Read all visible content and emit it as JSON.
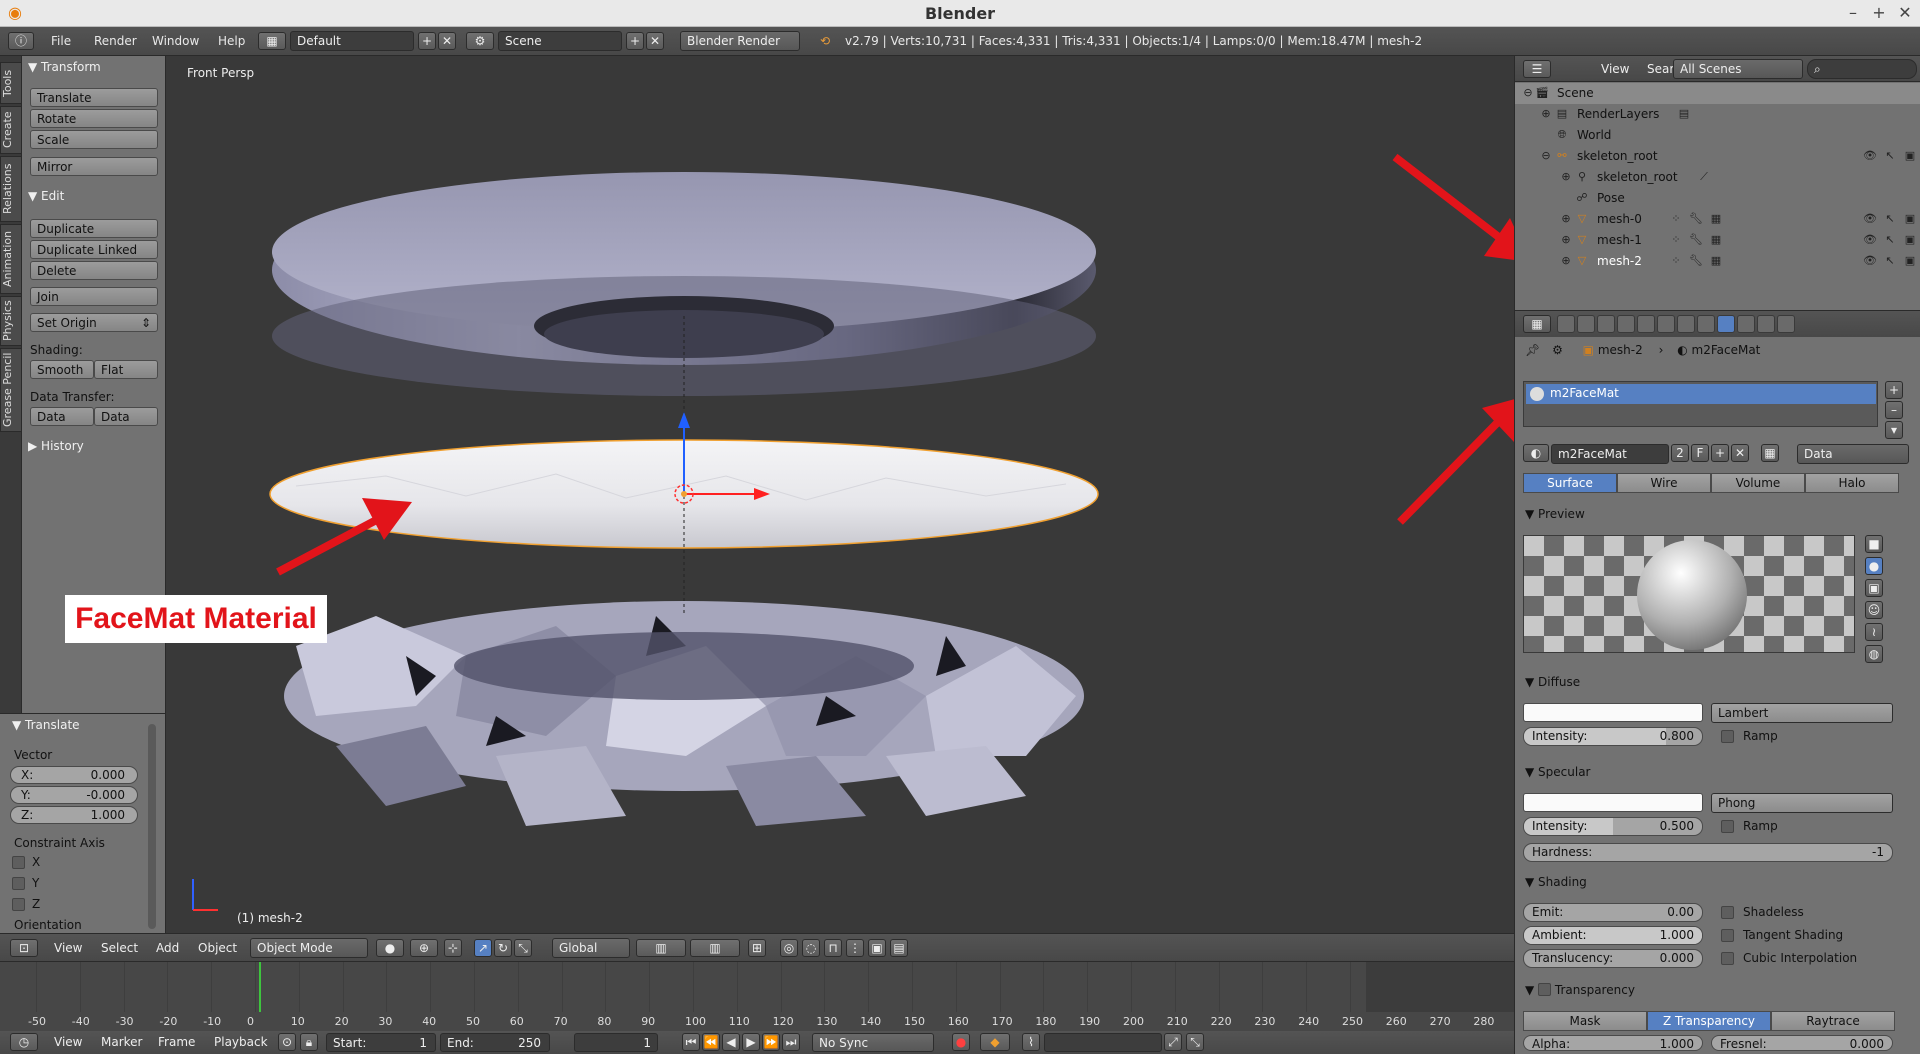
{
  "window": {
    "title": "Blender",
    "minimize": "–",
    "maximize": "+",
    "close": "✕"
  },
  "menu": {
    "file": "File",
    "render": "Render",
    "window": "Window",
    "help": "Help"
  },
  "info": {
    "layout": "Default",
    "scene": "Scene",
    "engine": "Blender Render",
    "stats": "v2.79 | Verts:10,731 | Faces:4,331 | Tris:4,331 | Objects:1/4 | Lamps:0/0 | Mem:18.47M | mesh-2"
  },
  "vtabs": [
    "Tools",
    "Create",
    "Relations",
    "Animation",
    "Physics",
    "Grease Pencil"
  ],
  "tools": {
    "transform_header": "Transform",
    "translate": "Translate",
    "rotate": "Rotate",
    "scale": "Scale",
    "mirror": "Mirror",
    "edit_header": "Edit",
    "duplicate": "Duplicate",
    "duplicate_linked": "Duplicate Linked",
    "delete": "Delete",
    "join": "Join",
    "set_origin": "Set Origin",
    "shading_label": "Shading:",
    "smooth": "Smooth",
    "flat": "Flat",
    "data_transfer_label": "Data Transfer:",
    "data": "Data",
    "data_layout": "Data Layo",
    "history_header": "History"
  },
  "operator": {
    "header": "Translate",
    "vector_label": "Vector",
    "x_label": "X:",
    "x_value": "0.000",
    "y_label": "Y:",
    "y_value": "-0.000",
    "z_label": "Z:",
    "z_value": "1.000",
    "constraint_label": "Constraint Axis",
    "axis_x": "X",
    "axis_y": "Y",
    "axis_z": "Z",
    "orientation_label": "Orientation"
  },
  "viewport": {
    "view_label": "Front Persp",
    "object_label": "(1) mesh-2",
    "annotation": "FaceMat Material"
  },
  "vpheader": {
    "view": "View",
    "select": "Select",
    "add": "Add",
    "object": "Object",
    "mode": "Object Mode",
    "orientation": "Global"
  },
  "timeline": {
    "ticks": [
      "-50",
      "-40",
      "-30",
      "-20",
      "-10",
      "0",
      "10",
      "20",
      "30",
      "40",
      "50",
      "60",
      "70",
      "80",
      "90",
      "100",
      "110",
      "120",
      "130",
      "140",
      "150",
      "160",
      "170",
      "180",
      "190",
      "200",
      "210",
      "220",
      "230",
      "240",
      "250",
      "260",
      "270",
      "280"
    ],
    "view": "View",
    "marker": "Marker",
    "frame": "Frame",
    "playback": "Playback",
    "start": "Start:",
    "start_val": "1",
    "end": "End:",
    "end_val": "250",
    "current": "1",
    "sync": "No Sync"
  },
  "outliner": {
    "view": "View",
    "search": "Search",
    "filter": "All Scenes",
    "rows": [
      "Scene",
      "RenderLayers",
      "World",
      "skeleton_root",
      "skeleton_root",
      "Pose",
      "mesh-0",
      "mesh-1",
      "mesh-2"
    ]
  },
  "properties": {
    "breadcrumb_object": "mesh-2",
    "breadcrumb_material": "m2FaceMat",
    "slot": "m2FaceMat",
    "material_name": "m2FaceMat",
    "users": "2",
    "fake": "F",
    "link": "Data",
    "tabs": [
      "Surface",
      "Wire",
      "Volume",
      "Halo"
    ],
    "preview_header": "Preview",
    "diffuse_header": "Diffuse",
    "diffuse_shader": "Lambert",
    "diffuse_intensity_label": "Intensity:",
    "diffuse_intensity": "0.800",
    "ramp": "Ramp",
    "specular_header": "Specular",
    "specular_shader": "Phong",
    "specular_intensity_label": "Intensity:",
    "specular_intensity": "0.500",
    "hardness_label": "Hardness:",
    "hardness": "-1",
    "shading_header": "Shading",
    "emit_label": "Emit:",
    "emit": "0.00",
    "ambient_label": "Ambient:",
    "ambient": "1.000",
    "translucency_label": "Translucency:",
    "translucency": "0.000",
    "shadeless": "Shadeless",
    "tangent_shading": "Tangent Shading",
    "cubic_interpolation": "Cubic Interpolation",
    "transparency_header": "Transparency",
    "trans_tabs": [
      "Mask",
      "Z Transparency",
      "Raytrace"
    ],
    "alpha_label": "Alpha:",
    "alpha": "1.000",
    "fresnel_label": "Fresnel:",
    "fresnel": "0.000"
  },
  "colors": {
    "accent": "#5680c2",
    "arrow": "#e2141a",
    "selection": "#f0a030"
  }
}
